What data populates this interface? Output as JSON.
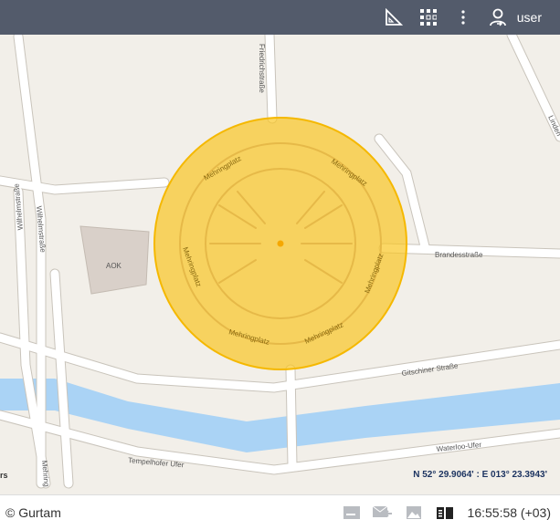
{
  "header": {
    "user": "user",
    "icons": [
      "ruler-triangle-icon",
      "apps-grid-icon",
      "more-vert-icon",
      "user-icon"
    ]
  },
  "map": {
    "labels": {
      "friedrichstrasse": "Friedrichstraße",
      "wilhelmstrasse1": "Wilhelmstraße",
      "wilhelmstrasse2": "Wilhelmstraße",
      "aok": "AOK",
      "mehringplatz": "Mehringplatz",
      "brandesstrasse": "Brandesstraße",
      "gitschiner": "Gitschiner Straße",
      "tempelhofer": "Tempelhofer Ufer",
      "waterloo": "Waterloo-Ufer",
      "linden": "Linden",
      "mehring_s": "Mehring",
      "partial": "rs"
    },
    "coordinates": "N 52° 29.9064' : E 013° 23.3943'",
    "circle_color": "#f9c623"
  },
  "footer": {
    "copyright": "© Gurtam",
    "time": "16:55:58 (+03)",
    "icons": [
      "card-icon",
      "mail-forward-icon",
      "image-icon",
      "layout-icon"
    ]
  }
}
